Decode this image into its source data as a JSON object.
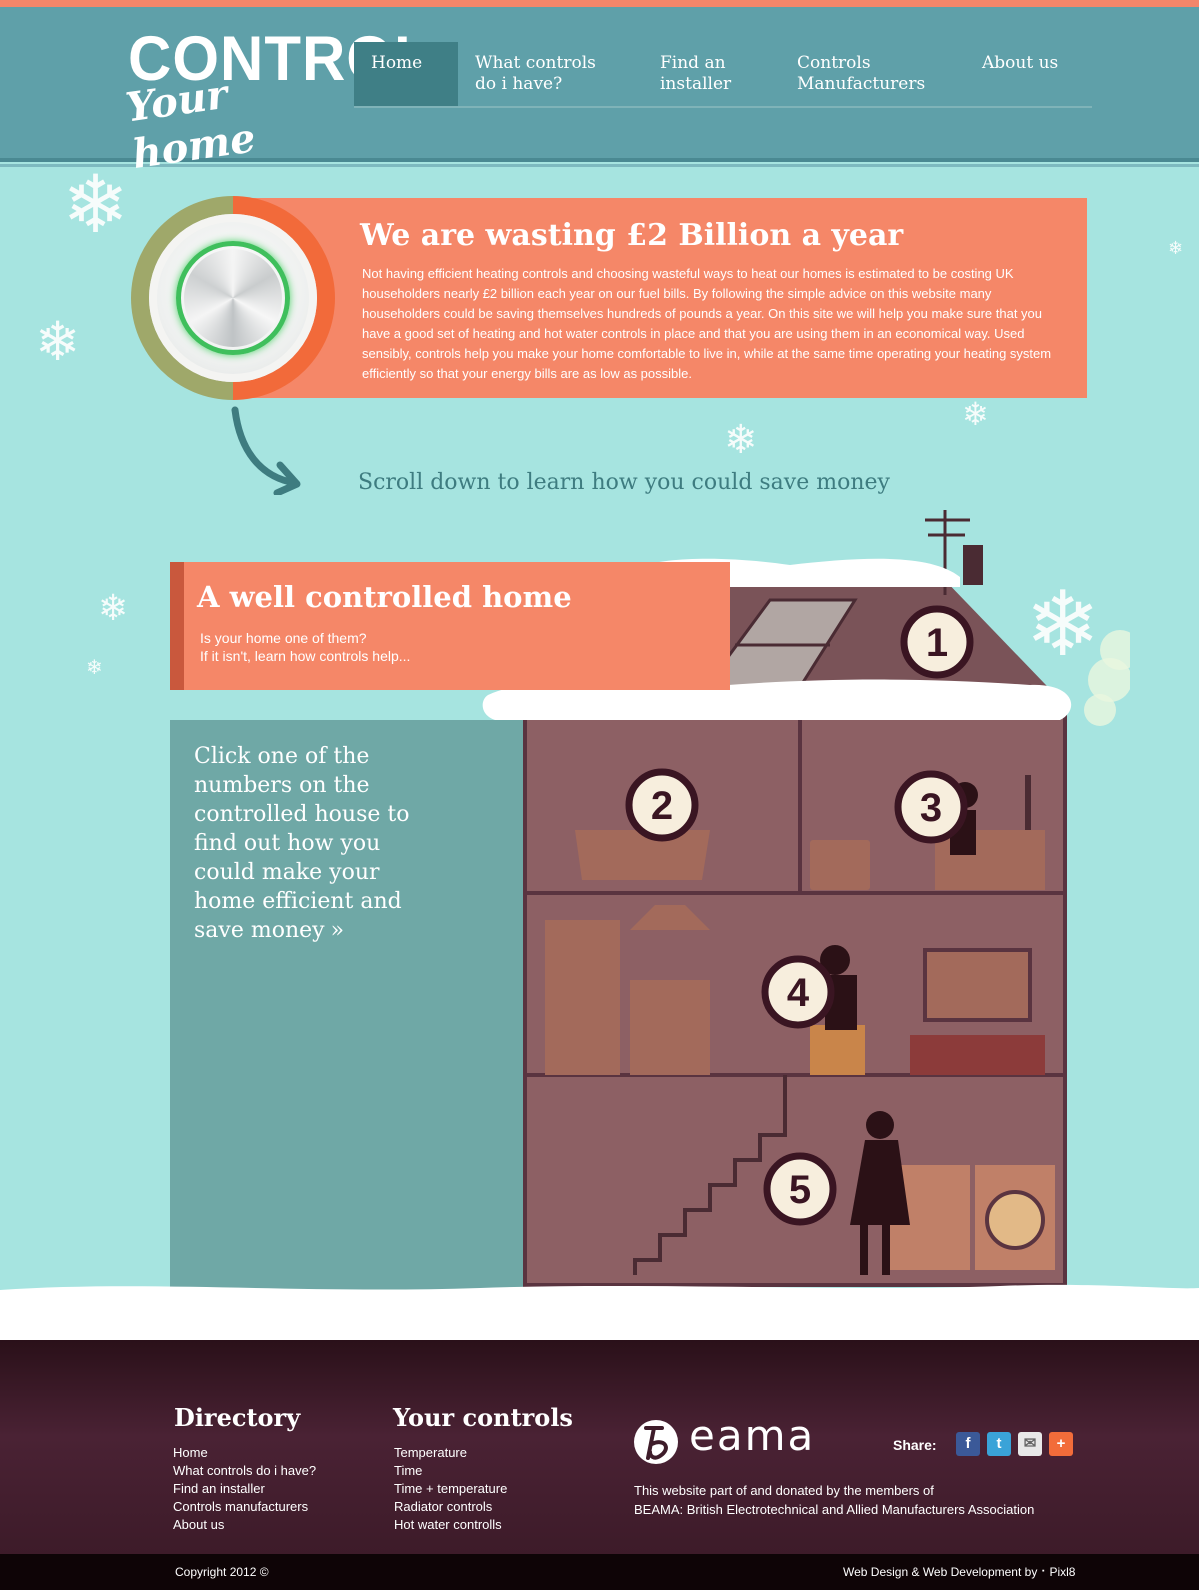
{
  "header": {
    "logo_line1": "CONTROL",
    "logo_line2": "Your home",
    "nav": [
      {
        "line1": "Home",
        "line2": ""
      },
      {
        "line1": "What controls",
        "line2": "do i have?"
      },
      {
        "line1": "Find an",
        "line2": "installer"
      },
      {
        "line1": "Controls",
        "line2": "Manufacturers"
      },
      {
        "line1": "About us",
        "line2": ""
      }
    ]
  },
  "hero": {
    "title": "We are wasting £2 Billion a year",
    "body": "Not having efficient heating controls and choosing wasteful ways to heat our homes is estimated to be costing UK householders nearly £2 billion each year on our fuel bills. By following the simple advice on this website many householders could be saving themselves hundreds of pounds a year. On this site we will help you make sure that you have a good set of heating and hot water controls in place and that you are using them in an economical way. Used sensibly, controls help you make your home comfortable to live in, while at the same time operating your heating system efficiently so that your energy bills are as low as possible.",
    "scroll_text": "Scroll down to learn how you could save money"
  },
  "house_section": {
    "title": "A well controlled home",
    "sub1": "Is your home one of them?",
    "sub2": "If it isn't, learn how controls help...",
    "instructions": "Click one of the numbers on the controlled house to find out how you could make your home efficient and save money",
    "chevron": "»",
    "numbers": [
      "1",
      "2",
      "3",
      "4",
      "5"
    ]
  },
  "footer": {
    "directory_title": "Directory",
    "directory_links": [
      "Home",
      "What controls do i have?",
      "Find an installer",
      "Controls manufacturers",
      "About us"
    ],
    "controls_title": "Your controls",
    "controls_links": [
      "Temperature",
      "Time",
      "Time + temperature",
      "Radiator controls",
      "Hot water controlls"
    ],
    "beama": "eama",
    "donated_line1": "This website part of and donated by the members of",
    "donated_line2": "BEAMA: British Electrotechnical and Allied Manufacturers Association",
    "share_label": "Share:",
    "share_icons": [
      "facebook-icon",
      "twitter-icon",
      "email-icon",
      "plus-icon"
    ],
    "share_glyphs": [
      "f",
      "t",
      "✉",
      "+"
    ],
    "copyright": "Copyright 2012 ©",
    "credit": "Web Design & Web Development by  ⠂Pixl8"
  },
  "colors": {
    "header": "#5fa0a9",
    "accent": "#f58768",
    "background": "#a6e4e0",
    "footer": "#3e1c2a"
  }
}
